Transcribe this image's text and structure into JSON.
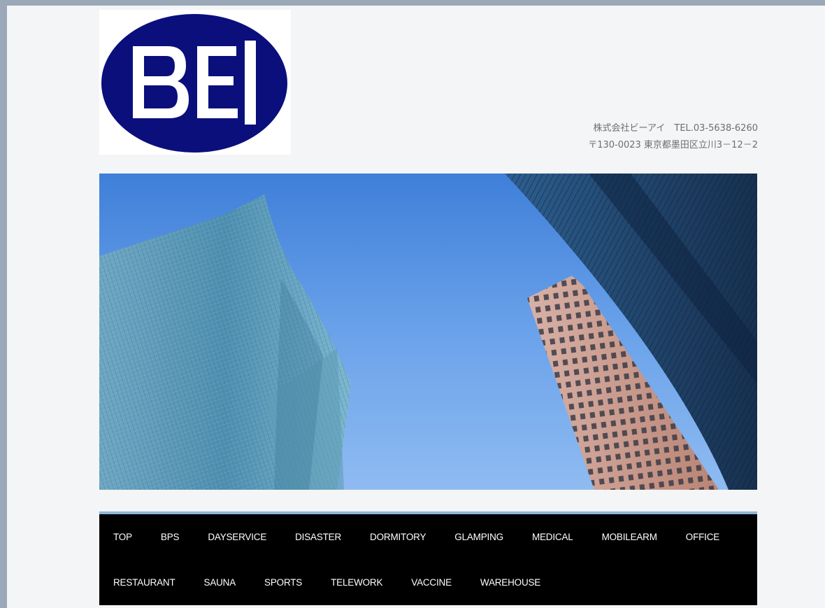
{
  "header": {
    "logo_text": "BEI",
    "company_line": "株式会社ビーアイ　TEL.03-5638-6260",
    "address_line": "〒130-0023 東京都墨田区立川3－12－2",
    "colors": {
      "logo_oval": "#0b0f7c",
      "logo_letters": "#ffffff"
    }
  },
  "hero": {
    "description_icon": "skyscrapers-photo",
    "colors": {
      "sky": "#6aa2ea",
      "glass_tower": "#4f8fb0",
      "dark_tower": "#1f3e66",
      "brick_tower": "#c79a8d"
    }
  },
  "nav": {
    "row1": [
      "TOP",
      "BPS",
      "DAYSERVICE",
      "DISASTER",
      "DORMITORY",
      "GLAMPING",
      "MEDICAL",
      "MOBILEARM",
      "OFFICE"
    ],
    "row2": [
      "RESTAURANT",
      "SAUNA",
      "SPORTS",
      "TELEWORK",
      "VACCINE",
      "WAREHOUSE"
    ],
    "colors": {
      "background": "#000000",
      "accent_border": "#8fb7d6",
      "text": "#ffffff"
    }
  }
}
